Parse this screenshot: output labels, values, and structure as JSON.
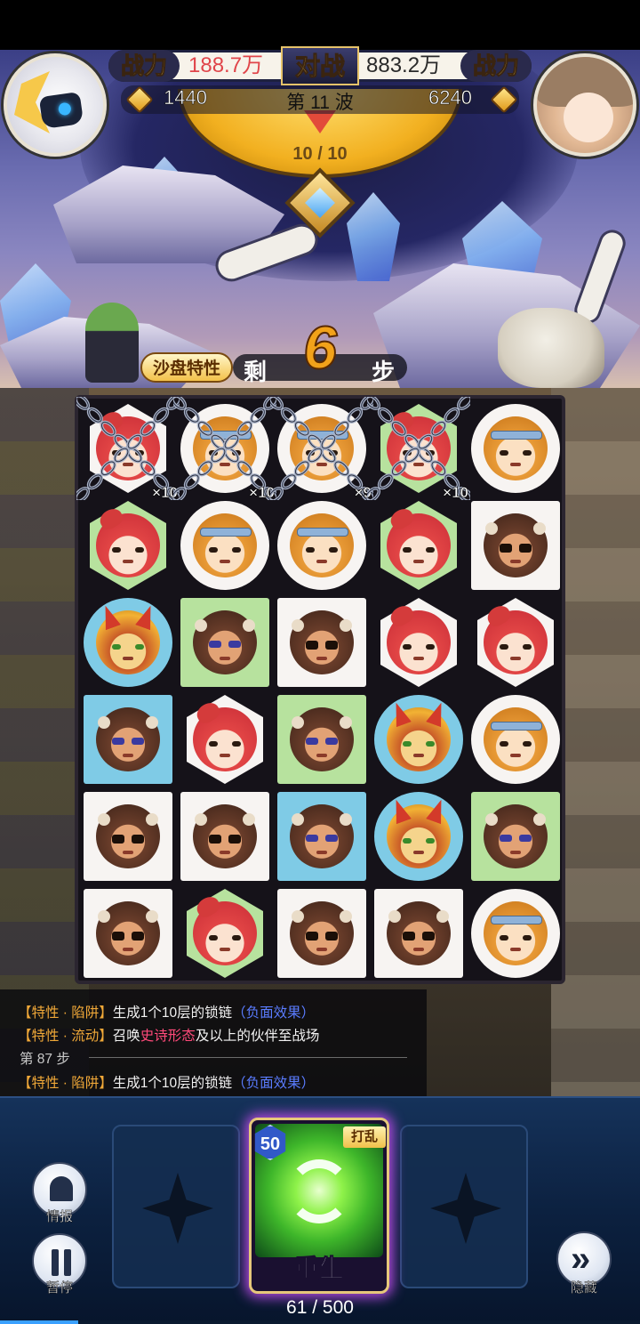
{
  "hud": {
    "power_label": "战力",
    "vs_label": "对战",
    "player_power": "188.7万",
    "enemy_power": "883.2万",
    "player_coins": "1440",
    "enemy_coins": "6240",
    "wave_label": "第 11 波",
    "wave_progress": "10 / 10"
  },
  "colors": {
    "player_power": "#e0454a",
    "enemy_power": "#2a2a2a",
    "accent_gold": "#f2a21a",
    "negative_effect": "#5a7cff",
    "epic_form": "#ff4a7a"
  },
  "sandbox": {
    "badge": "沙盘特性",
    "remaining_prefix": "剩",
    "remaining_steps": "6",
    "remaining_suffix": "步"
  },
  "board": {
    "rows": 6,
    "cols": 5,
    "cells": [
      {
        "char": "red",
        "bg": "white",
        "shape": "hex",
        "chain": "×10"
      },
      {
        "char": "monkey",
        "bg": "white",
        "shape": "circle",
        "chain": "×10"
      },
      {
        "char": "monkey",
        "bg": "white",
        "shape": "circle",
        "chain": "×9"
      },
      {
        "char": "red",
        "bg": "green",
        "shape": "hex",
        "chain": "×10"
      },
      {
        "char": "monkey",
        "bg": "white",
        "shape": "circle",
        "chain": ""
      },
      {
        "char": "red",
        "bg": "green",
        "shape": "hex",
        "chain": ""
      },
      {
        "char": "monkey",
        "bg": "white",
        "shape": "circle",
        "chain": ""
      },
      {
        "char": "monkey",
        "bg": "white",
        "shape": "circle",
        "chain": ""
      },
      {
        "char": "red",
        "bg": "green",
        "shape": "hex",
        "chain": ""
      },
      {
        "char": "dark",
        "bg": "white",
        "shape": "square",
        "chain": ""
      },
      {
        "char": "gold",
        "bg": "blue",
        "shape": "circle",
        "chain": ""
      },
      {
        "char": "dark-sleepy",
        "bg": "green",
        "shape": "square",
        "chain": ""
      },
      {
        "char": "dark",
        "bg": "white",
        "shape": "square",
        "chain": ""
      },
      {
        "char": "red",
        "bg": "white",
        "shape": "hex",
        "chain": ""
      },
      {
        "char": "red",
        "bg": "white",
        "shape": "hex",
        "chain": ""
      },
      {
        "char": "dark-sleepy",
        "bg": "blue",
        "shape": "square",
        "chain": ""
      },
      {
        "char": "red",
        "bg": "white",
        "shape": "hex",
        "chain": ""
      },
      {
        "char": "dark-sleepy",
        "bg": "green",
        "shape": "square",
        "chain": ""
      },
      {
        "char": "gold",
        "bg": "blue",
        "shape": "circle",
        "chain": ""
      },
      {
        "char": "monkey",
        "bg": "white",
        "shape": "circle",
        "chain": ""
      },
      {
        "char": "dark",
        "bg": "white",
        "shape": "square",
        "chain": ""
      },
      {
        "char": "dark",
        "bg": "white",
        "shape": "square",
        "chain": ""
      },
      {
        "char": "dark-sleepy",
        "bg": "blue",
        "shape": "square",
        "chain": ""
      },
      {
        "char": "gold",
        "bg": "blue",
        "shape": "circle",
        "chain": ""
      },
      {
        "char": "dark-sleepy",
        "bg": "green",
        "shape": "square",
        "chain": ""
      },
      {
        "char": "dark",
        "bg": "white",
        "shape": "square",
        "chain": ""
      },
      {
        "char": "red",
        "bg": "green",
        "shape": "hex",
        "chain": ""
      },
      {
        "char": "dark",
        "bg": "white",
        "shape": "square",
        "chain": ""
      },
      {
        "char": "dark",
        "bg": "white",
        "shape": "square",
        "chain": ""
      },
      {
        "char": "monkey",
        "bg": "white",
        "shape": "circle",
        "chain": ""
      }
    ]
  },
  "log": {
    "line1": {
      "tag": "【特性 · 陷阱】",
      "text": "生成1个10层的锁链",
      "neg": "（负面效果）"
    },
    "line2": {
      "tag": "【特性 · 流动】",
      "text_a": "召唤",
      "epic": "史诗形态",
      "text_b": "及以上的伙伴至战场"
    },
    "step": "第 87 步",
    "line3": {
      "tag": "【特性 · 陷阱】",
      "text": "生成1个10层的锁链",
      "neg": "（负面效果）"
    }
  },
  "controls": {
    "intel_label": "情报",
    "pause_label": "暂停",
    "hide_label": "隐藏"
  },
  "skill_card": {
    "cost": "50",
    "tag": "打乱",
    "name": "重生"
  },
  "energy": "61 / 500",
  "icons": {
    "intel": "siren-icon",
    "pause": "pause-icon",
    "hide": "double-chevron-icon",
    "coin": "diamond-coin-icon",
    "card_art": "rebirth-swirl-icon"
  }
}
